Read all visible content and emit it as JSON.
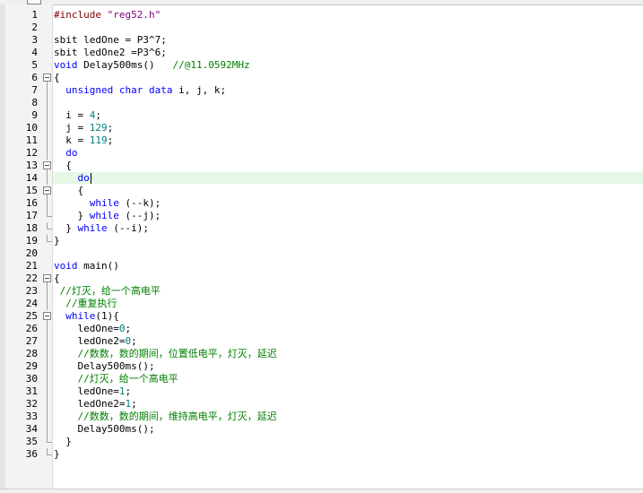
{
  "editor": {
    "language": "C",
    "active_line": 14,
    "colors": {
      "keyword": "#0000ff",
      "string": "#800080",
      "preprocessor": "#800000",
      "number": "#008080",
      "comment": "#008000",
      "current_line_bg": "#e6f8e6"
    },
    "lines": [
      {
        "num": "1",
        "fold": "none",
        "tokens": [
          {
            "t": "#include ",
            "c": "pre"
          },
          {
            "t": "\"reg52.h\"",
            "c": "str"
          }
        ]
      },
      {
        "num": "2",
        "fold": "none",
        "tokens": []
      },
      {
        "num": "3",
        "fold": "none",
        "tokens": [
          {
            "t": "sbit ledOne = P3^7;",
            "c": "plain"
          }
        ]
      },
      {
        "num": "4",
        "fold": "none",
        "tokens": [
          {
            "t": "sbit ledOne2 =P3^6;",
            "c": "plain"
          }
        ]
      },
      {
        "num": "5",
        "fold": "none",
        "tokens": [
          {
            "t": "void",
            "c": "kw"
          },
          {
            "t": " Delay500ms()   ",
            "c": "plain"
          },
          {
            "t": "//@11.0592MHz",
            "c": "cmt"
          }
        ]
      },
      {
        "num": "6",
        "fold": "open",
        "tokens": [
          {
            "t": "{",
            "c": "plain"
          }
        ]
      },
      {
        "num": "7",
        "fold": "line",
        "tokens": [
          {
            "t": "  ",
            "c": "plain"
          },
          {
            "t": "unsigned char data",
            "c": "kw"
          },
          {
            "t": " i, j, k;",
            "c": "plain"
          }
        ]
      },
      {
        "num": "8",
        "fold": "line",
        "tokens": []
      },
      {
        "num": "9",
        "fold": "line",
        "tokens": [
          {
            "t": "  i = ",
            "c": "plain"
          },
          {
            "t": "4",
            "c": "num"
          },
          {
            "t": ";",
            "c": "plain"
          }
        ]
      },
      {
        "num": "10",
        "fold": "line",
        "tokens": [
          {
            "t": "  j = ",
            "c": "plain"
          },
          {
            "t": "129",
            "c": "num"
          },
          {
            "t": ";",
            "c": "plain"
          }
        ]
      },
      {
        "num": "11",
        "fold": "line",
        "tokens": [
          {
            "t": "  k = ",
            "c": "plain"
          },
          {
            "t": "119",
            "c": "num"
          },
          {
            "t": ";",
            "c": "plain"
          }
        ]
      },
      {
        "num": "12",
        "fold": "line",
        "tokens": [
          {
            "t": "  ",
            "c": "plain"
          },
          {
            "t": "do",
            "c": "kw"
          }
        ]
      },
      {
        "num": "13",
        "fold": "open",
        "tokens": [
          {
            "t": "  {",
            "c": "plain"
          }
        ]
      },
      {
        "num": "14",
        "fold": "line",
        "tokens": [
          {
            "t": "    ",
            "c": "plain"
          },
          {
            "t": "do",
            "c": "kw"
          }
        ]
      },
      {
        "num": "15",
        "fold": "open",
        "tokens": [
          {
            "t": "    {",
            "c": "plain"
          }
        ]
      },
      {
        "num": "16",
        "fold": "line",
        "tokens": [
          {
            "t": "      ",
            "c": "plain"
          },
          {
            "t": "while",
            "c": "kw"
          },
          {
            "t": " (--k);",
            "c": "plain"
          }
        ]
      },
      {
        "num": "17",
        "fold": "end",
        "tokens": [
          {
            "t": "    } ",
            "c": "plain"
          },
          {
            "t": "while",
            "c": "kw"
          },
          {
            "t": " (--j);",
            "c": "plain"
          }
        ]
      },
      {
        "num": "18",
        "fold": "end",
        "tokens": [
          {
            "t": "  } ",
            "c": "plain"
          },
          {
            "t": "while",
            "c": "kw"
          },
          {
            "t": " (--i);",
            "c": "plain"
          }
        ]
      },
      {
        "num": "19",
        "fold": "end",
        "tokens": [
          {
            "t": "}",
            "c": "plain"
          }
        ]
      },
      {
        "num": "20",
        "fold": "none",
        "tokens": []
      },
      {
        "num": "21",
        "fold": "none",
        "tokens": [
          {
            "t": "void",
            "c": "kw"
          },
          {
            "t": " main()",
            "c": "plain"
          }
        ]
      },
      {
        "num": "22",
        "fold": "open",
        "tokens": [
          {
            "t": "{",
            "c": "plain"
          }
        ]
      },
      {
        "num": "23",
        "fold": "line",
        "tokens": [
          {
            "t": " ",
            "c": "plain"
          },
          {
            "t": "//灯灭，给一个高电平",
            "c": "cmt"
          }
        ]
      },
      {
        "num": "24",
        "fold": "line",
        "tokens": [
          {
            "t": "  ",
            "c": "plain"
          },
          {
            "t": "//重复执行",
            "c": "cmt"
          }
        ]
      },
      {
        "num": "25",
        "fold": "open",
        "tokens": [
          {
            "t": "  ",
            "c": "plain"
          },
          {
            "t": "while",
            "c": "kw"
          },
          {
            "t": "(1){",
            "c": "plain"
          }
        ]
      },
      {
        "num": "26",
        "fold": "line",
        "tokens": [
          {
            "t": "    ledOne=",
            "c": "plain"
          },
          {
            "t": "0",
            "c": "num"
          },
          {
            "t": ";",
            "c": "plain"
          }
        ]
      },
      {
        "num": "27",
        "fold": "line",
        "tokens": [
          {
            "t": "    ledOne2=",
            "c": "plain"
          },
          {
            "t": "0",
            "c": "num"
          },
          {
            "t": ";",
            "c": "plain"
          }
        ]
      },
      {
        "num": "28",
        "fold": "line",
        "tokens": [
          {
            "t": "    ",
            "c": "plain"
          },
          {
            "t": "//数数，数的期间，位置低电平，灯灭，延迟",
            "c": "cmt"
          }
        ]
      },
      {
        "num": "29",
        "fold": "line",
        "tokens": [
          {
            "t": "    Delay500ms();",
            "c": "plain"
          }
        ]
      },
      {
        "num": "30",
        "fold": "line",
        "tokens": [
          {
            "t": "    ",
            "c": "plain"
          },
          {
            "t": "//灯灭，给一个高电平",
            "c": "cmt"
          }
        ]
      },
      {
        "num": "31",
        "fold": "line",
        "tokens": [
          {
            "t": "    ledOne=",
            "c": "plain"
          },
          {
            "t": "1",
            "c": "num"
          },
          {
            "t": ";",
            "c": "plain"
          }
        ]
      },
      {
        "num": "32",
        "fold": "line",
        "tokens": [
          {
            "t": "    ledOne2=",
            "c": "plain"
          },
          {
            "t": "1",
            "c": "num"
          },
          {
            "t": ";",
            "c": "plain"
          }
        ]
      },
      {
        "num": "33",
        "fold": "line",
        "tokens": [
          {
            "t": "    ",
            "c": "plain"
          },
          {
            "t": "//数数，数的期间，维持高电平，灯灭，延迟",
            "c": "cmt"
          }
        ]
      },
      {
        "num": "34",
        "fold": "line",
        "tokens": [
          {
            "t": "    Delay500ms();",
            "c": "plain"
          }
        ]
      },
      {
        "num": "35",
        "fold": "end",
        "tokens": [
          {
            "t": "  }",
            "c": "plain"
          }
        ]
      },
      {
        "num": "36",
        "fold": "end",
        "tokens": [
          {
            "t": "}",
            "c": "plain"
          }
        ]
      }
    ]
  }
}
